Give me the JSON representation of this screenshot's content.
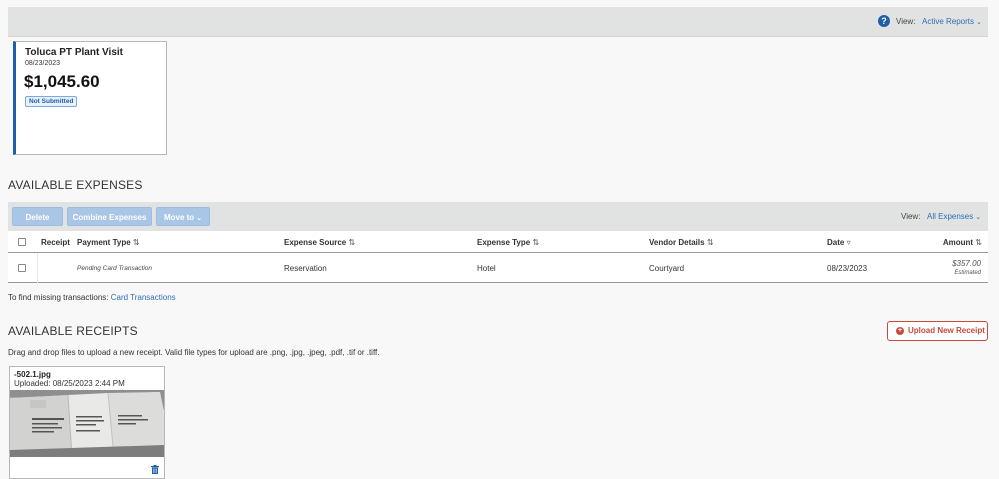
{
  "header": {
    "view_label": "View:",
    "view_value": "Active Reports"
  },
  "report_card": {
    "name": "Toluca PT Plant Visit",
    "date": "08/23/2023",
    "amount": "$1,045.60",
    "status": "Not Submitted"
  },
  "expenses": {
    "title": "AVAILABLE EXPENSES",
    "buttons": {
      "delete": "Delete",
      "combine": "Combine Expenses",
      "move_to": "Move to"
    },
    "view_label": "View:",
    "view_value": "All Expenses",
    "columns": {
      "receipt": "Receipt",
      "payment_type": "Payment Type",
      "expense_source": "Expense Source",
      "expense_type": "Expense Type",
      "vendor_details": "Vendor Details",
      "date": "Date",
      "amount": "Amount"
    },
    "rows": [
      {
        "payment_type": "Pending Card Transaction",
        "expense_source": "Reservation",
        "expense_type": "Hotel",
        "vendor_details": "Courtyard",
        "date": "08/23/2023",
        "amount": "$357.00",
        "amount_note": "Estimated"
      }
    ],
    "missing_text": "To find missing transactions:",
    "missing_link": "Card Transactions"
  },
  "receipts": {
    "title": "AVAILABLE RECEIPTS",
    "upload_button": "Upload New Receipt",
    "drag_text": "Drag and drop files to upload a new receipt. Valid file types for upload are .png, .jpg, .jpeg, .pdf, .tif or .tiff.",
    "items": [
      {
        "filename": "-502.1.jpg",
        "uploaded": "Uploaded: 08/25/2023 2:44 PM"
      }
    ]
  },
  "icons": {
    "help": "help-icon",
    "chevron": "chevron-down-icon",
    "sort": "sort-icon",
    "plus": "plus-circle-icon",
    "trash": "trash-icon"
  },
  "colors": {
    "accent": "#1f5fa8",
    "link": "#2d6eb4",
    "upload": "#c74b3a",
    "button_disabled": "#a9c6e6"
  }
}
